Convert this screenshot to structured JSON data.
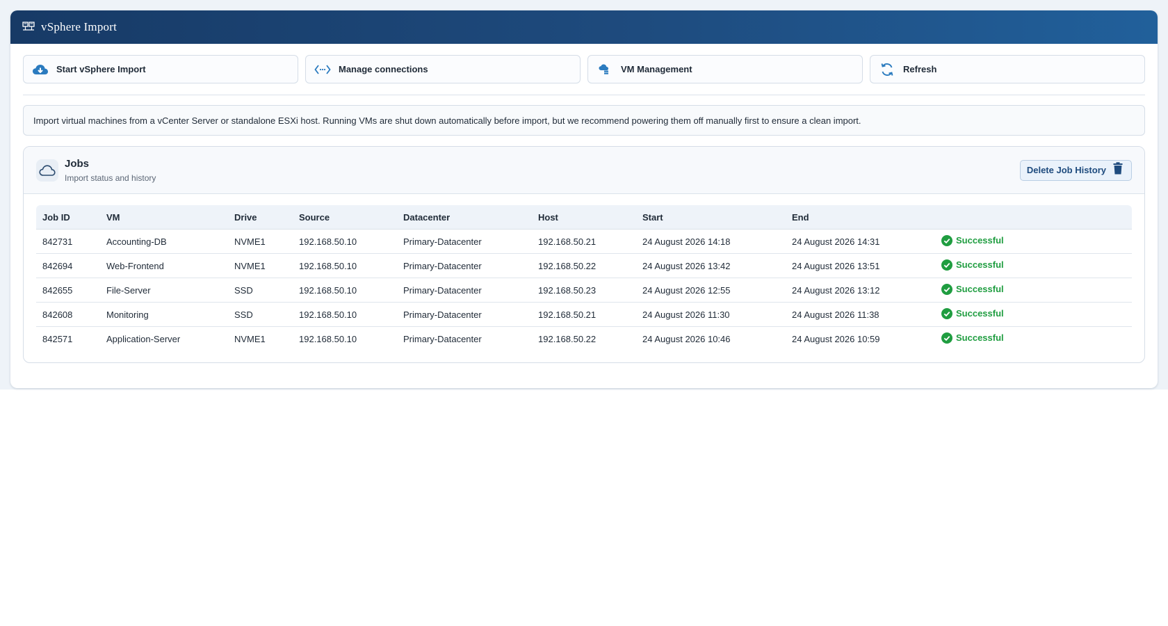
{
  "window": {
    "title": "vSphere  Import",
    "title_icon": "server-network-icon"
  },
  "toolbar": {
    "buttons": [
      {
        "label": "Start vSphere Import",
        "icon": "cloud-download-icon"
      },
      {
        "label": "Manage connections",
        "icon": "code-connections-icon"
      },
      {
        "label": "VM Management",
        "icon": "cloud-server-icon"
      },
      {
        "label": "Refresh",
        "icon": "refresh-icon"
      }
    ]
  },
  "info": {
    "text": "Import virtual machines from a vCenter Server or standalone ESXi host. Running VMs are shut down automatically before import, but we recommend powering them off manually first to ensure a clean import."
  },
  "jobs": {
    "title": "Jobs",
    "subtitle": "Import status and history",
    "icon": "cloud-icon",
    "delete_label": "Delete Job History",
    "delete_icon": "trash-icon",
    "columns": [
      "Job ID",
      "VM",
      "Drive",
      "Source",
      "Datacenter",
      "Host",
      "Start",
      "End",
      ""
    ],
    "rows": [
      {
        "job_id": "842731",
        "vm": "Accounting-DB",
        "drive": "NVME1",
        "source": "192.168.50.10",
        "datacenter": "Primary-Datacenter",
        "host": "192.168.50.21",
        "start": "24 August 2026 14:18",
        "end": "24 August 2026 14:31",
        "status": "Successful"
      },
      {
        "job_id": "842694",
        "vm": "Web-Frontend",
        "drive": "NVME1",
        "source": "192.168.50.10",
        "datacenter": "Primary-Datacenter",
        "host": "192.168.50.22",
        "start": "24 August 2026 13:42",
        "end": "24 August 2026 13:51",
        "status": "Successful"
      },
      {
        "job_id": "842655",
        "vm": "File-Server",
        "drive": "SSD",
        "source": "192.168.50.10",
        "datacenter": "Primary-Datacenter",
        "host": "192.168.50.23",
        "start": "24 August 2026 12:55",
        "end": "24 August 2026 13:12",
        "status": "Successful"
      },
      {
        "job_id": "842608",
        "vm": "Monitoring",
        "drive": "SSD",
        "source": "192.168.50.10",
        "datacenter": "Primary-Datacenter",
        "host": "192.168.50.21",
        "start": "24 August 2026 11:30",
        "end": "24 August 2026 11:38",
        "status": "Successful"
      },
      {
        "job_id": "842571",
        "vm": "Application-Server",
        "drive": "NVME1",
        "source": "192.168.50.10",
        "datacenter": "Primary-Datacenter",
        "host": "192.168.50.22",
        "start": "24 August 2026 10:46",
        "end": "24 August 2026 10:59",
        "status": "Successful"
      }
    ]
  },
  "colors": {
    "title_bar": "#1e4b7e",
    "accent": "#2b7bbf",
    "success": "#1f9d40",
    "delete_text": "#1e4b7e"
  }
}
